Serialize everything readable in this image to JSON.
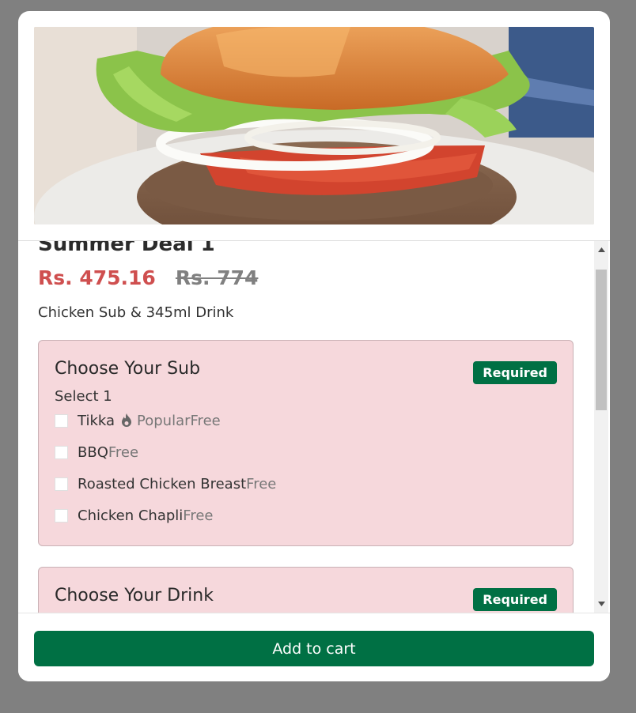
{
  "item": {
    "title": "Summer Deal 1",
    "price_now": "Rs. 475.16",
    "price_old": "Rs. 774",
    "description": "Chicken Sub & 345ml Drink"
  },
  "groups": [
    {
      "title": "Choose Your Sub",
      "badge": "Required",
      "select_hint": "Select 1",
      "options": [
        {
          "label": "Tikka",
          "tag": "Popular",
          "price": "Free"
        },
        {
          "label": "BBQ",
          "price": "Free"
        },
        {
          "label": "Roasted Chicken Breast",
          "price": "Free"
        },
        {
          "label": "Chicken Chapli",
          "price": "Free"
        }
      ]
    },
    {
      "title": "Choose Your Drink",
      "badge": "Required"
    }
  ],
  "footer": {
    "add_label": "Add to cart"
  },
  "colors": {
    "brand_green": "#007044",
    "price_red": "#cf4f4f",
    "group_bg": "#f6d8dc"
  },
  "icons": {
    "popular": "fire-icon",
    "scroll_up": "scroll-up-arrow-icon",
    "scroll_down": "scroll-down-arrow-icon"
  }
}
